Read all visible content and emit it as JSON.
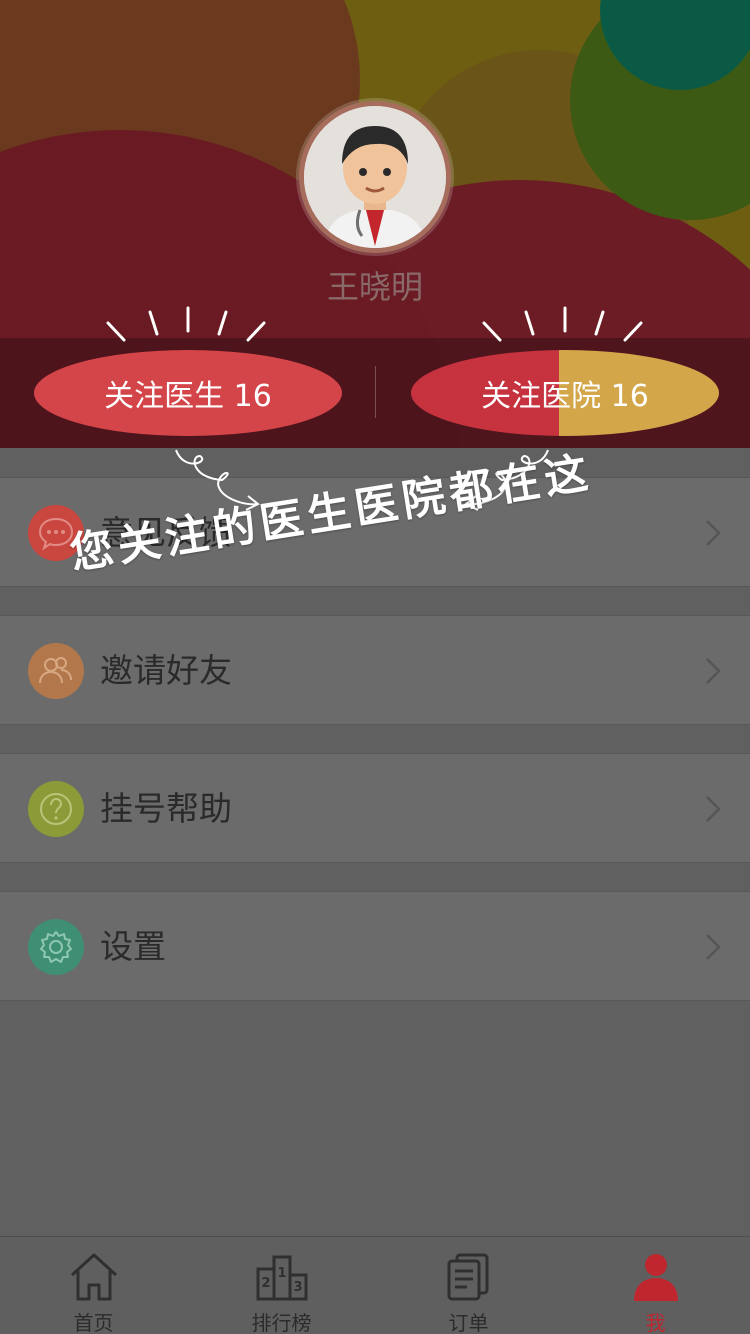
{
  "profile": {
    "username": "王晓明",
    "follow_doctors_label": "关注医生 16",
    "follow_hospitals_label": "关注医院 16"
  },
  "menu": [
    {
      "label": "意见反馈",
      "icon": "chat-bubble-icon",
      "color": "#c9473f"
    },
    {
      "label": "邀请好友",
      "icon": "users-icon",
      "color": "#b2784c"
    },
    {
      "label": "挂号帮助",
      "icon": "question-icon",
      "color": "#8c9a37"
    },
    {
      "label": "设置",
      "icon": "gear-icon",
      "color": "#3f8f74"
    }
  ],
  "hint": {
    "text": "您关注的医生医院都在这"
  },
  "tabbar": [
    {
      "label": "首页",
      "icon": "home-icon",
      "active": false
    },
    {
      "label": "排行榜",
      "icon": "podium-icon",
      "active": false
    },
    {
      "label": "订单",
      "icon": "document-icon",
      "active": false
    },
    {
      "label": "我",
      "icon": "user-icon",
      "active": true
    }
  ],
  "colors": {
    "accent": "#c0262d",
    "overlay": "#606060"
  }
}
